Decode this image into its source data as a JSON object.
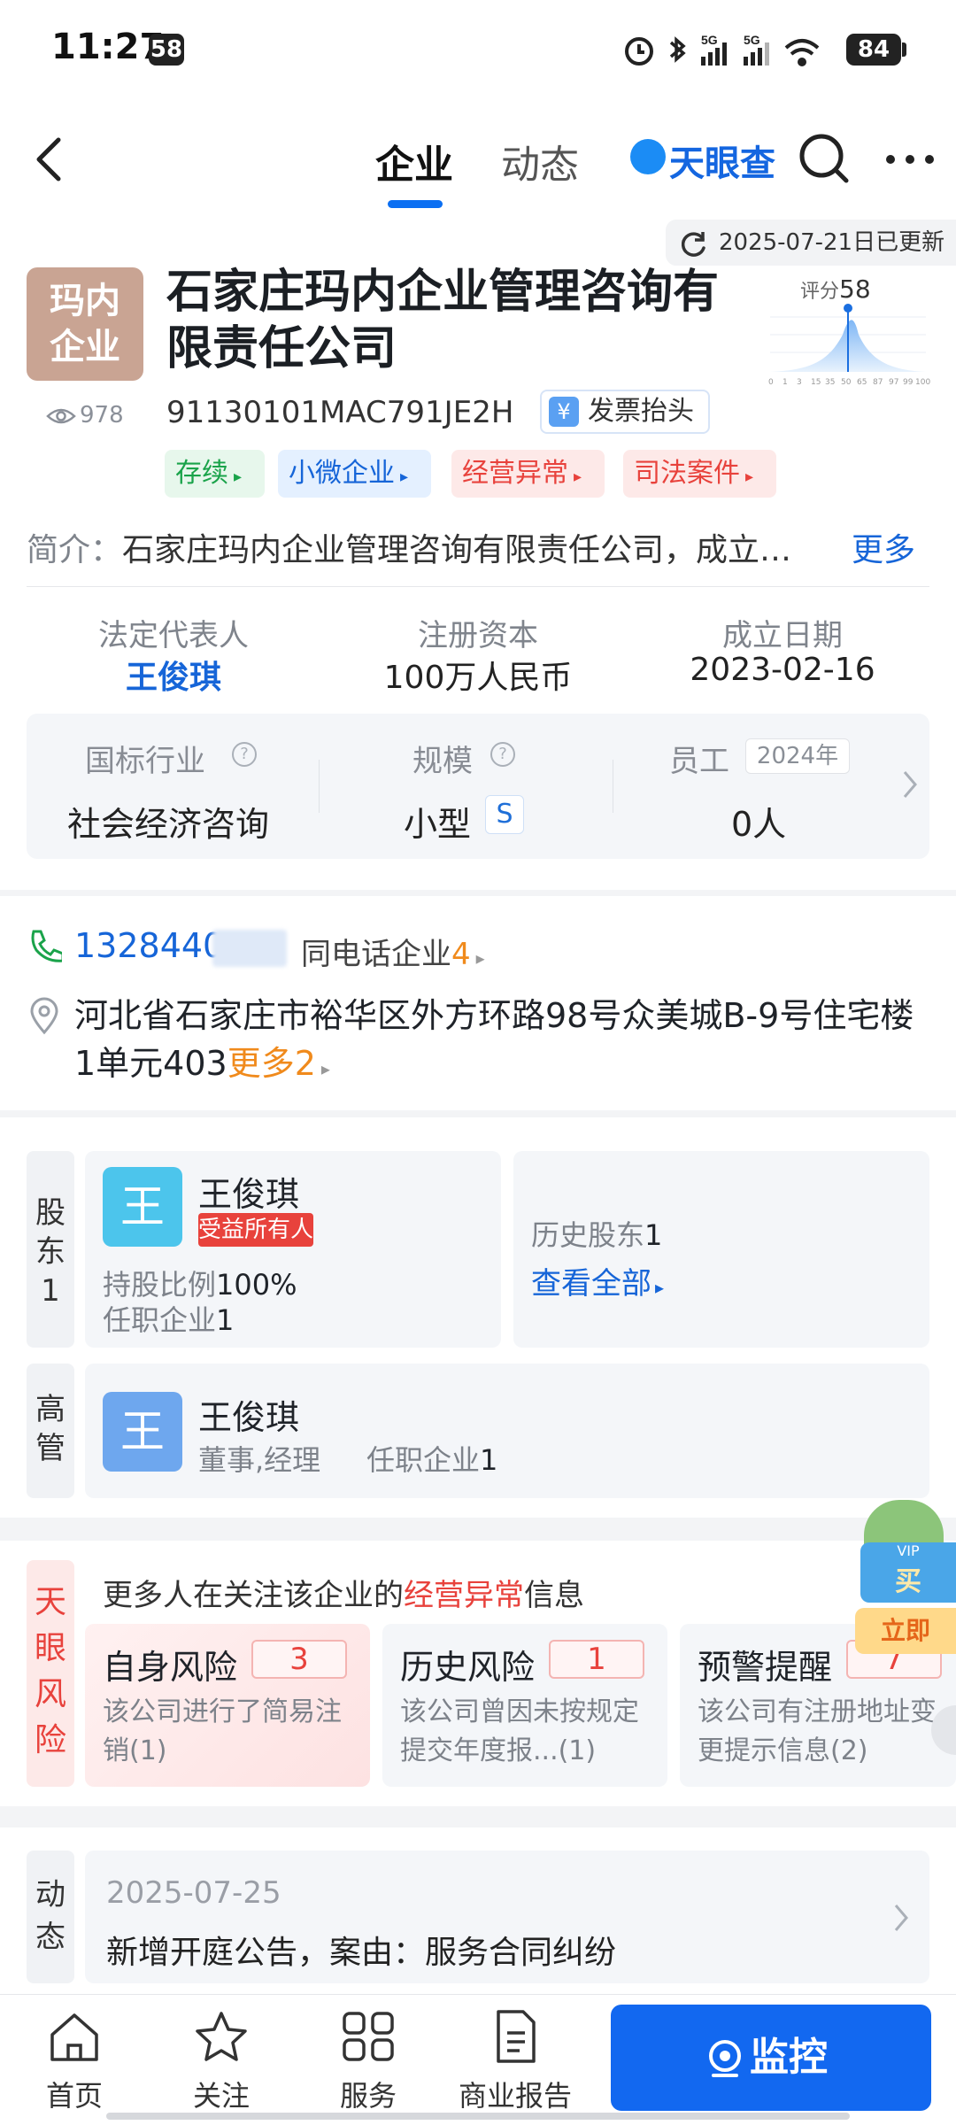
{
  "status_bar": {
    "time": "11:27",
    "notification_count": "58",
    "battery": "84"
  },
  "nav": {
    "tabs": [
      {
        "label": "企业",
        "active": true
      },
      {
        "label": "动态",
        "active": false
      }
    ],
    "brand": "天眼查"
  },
  "company": {
    "update_text": "2025-07-21日已更新",
    "logo_text_line1": "玛内",
    "logo_text_line2": "企业",
    "name": "石家庄玛内企业管理咨询有限责任公司",
    "views": "978",
    "score_label": "评分",
    "score_value": "58",
    "score_axis": [
      "0",
      "1",
      "3",
      "15",
      "35",
      "50",
      "65",
      "87",
      "97",
      "99",
      "100"
    ],
    "credit_code": "91130101MAC791JE2H",
    "invoice_label": "发票抬头",
    "tags": [
      "存续",
      "小微企业",
      "经营异常",
      "司法案件"
    ],
    "intro_label": "简介：",
    "intro_text": "石家庄玛内企业管理咨询有限责任公司，成立…",
    "intro_more": "更多",
    "legal_rep_label": "法定代表人",
    "legal_rep_value": "王俊琪",
    "capital_label": "注册资本",
    "capital_value": "100万人民币",
    "founded_label": "成立日期",
    "founded_value": "2023-02-16",
    "industry_label": "国标行业",
    "industry_value": "社会经济咨询",
    "scale_label": "规模",
    "scale_value": "小型",
    "scale_badge": "S",
    "staff_label": "员工",
    "staff_year": "2024年",
    "staff_value": "0人"
  },
  "contact": {
    "phone": "1328440",
    "same_phone_label": "同电话企业",
    "same_phone_count": "4",
    "address": "河北省石家庄市裕华区外方环路98号众美城B-9号住宅楼1单元403",
    "address_more_label": "更多",
    "address_more_count": "2"
  },
  "shareholders": {
    "side_label": "股东",
    "side_count": "1",
    "avatar_char": "王",
    "name": "王俊琪",
    "badge": "受益所有人",
    "ratio_label": "持股比例",
    "ratio_value": "100%",
    "post_label": "任职企业",
    "post_value": "1",
    "history_label": "历史股东",
    "history_count": "1",
    "view_all": "查看全部"
  },
  "executives": {
    "side_label": "高管",
    "avatar_char": "王",
    "name": "王俊琪",
    "roles": "董事,经理",
    "post_label": "任职企业",
    "post_value": "1"
  },
  "risk": {
    "side_label": "天眼风险",
    "headline_prefix": "更多人在关注该企业的",
    "headline_highlight": "经营异常",
    "headline_suffix": "信息",
    "cards": [
      {
        "title": "自身风险",
        "count": "3",
        "desc": "该公司进行了简易注销(1)"
      },
      {
        "title": "历史风险",
        "count": "1",
        "desc": "该公司曾因未按规定提交年度报...(1)"
      },
      {
        "title": "预警提醒",
        "count": "7",
        "desc": "该公司有注册地址变更提示信息(2)"
      }
    ],
    "vip_text1": "VIP",
    "vip_text2": "买",
    "vip_text3": "立即"
  },
  "dynamic": {
    "side_label": "动态",
    "date": "2025-07-25",
    "text": "新增开庭公告，案由：服务合同纠纷"
  },
  "bottom_nav": {
    "items": [
      "首页",
      "关注",
      "服务",
      "商业报告"
    ],
    "monitor": "监控"
  }
}
